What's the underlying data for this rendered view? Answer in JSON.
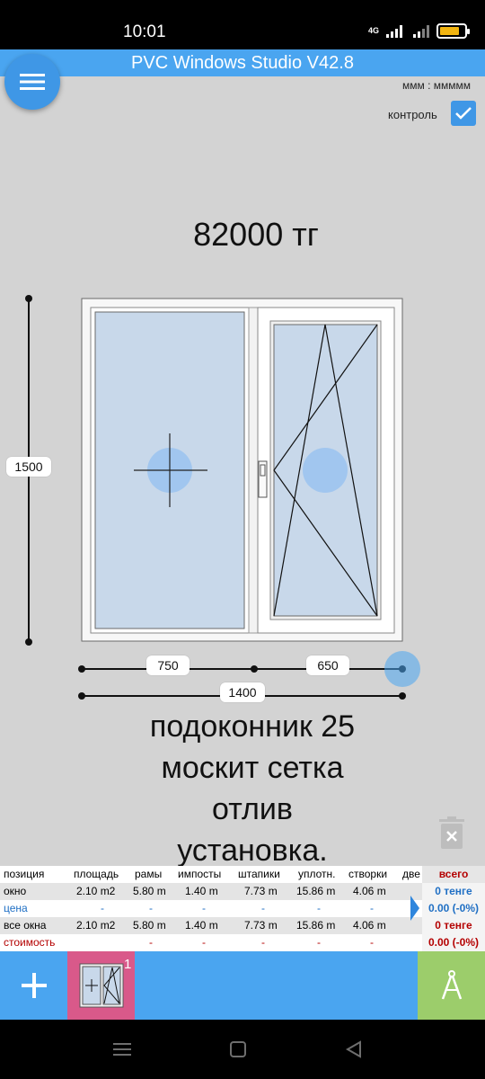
{
  "status": {
    "time": "10:01",
    "network": "4G",
    "battery_percent": 80
  },
  "app": {
    "title": "PVC Windows Studio V42.8",
    "units": "ммм : ммммм",
    "control_label": "контроль",
    "control_checked": true
  },
  "price": "82000 тг",
  "window": {
    "height": "1500",
    "sash_left_width": "750",
    "sash_right_width": "650",
    "total_width": "1400",
    "colors": {
      "glass": "#c8d8ea",
      "frame": "#f7f7f7",
      "handle_marker": "#9cc4ef"
    }
  },
  "notes": [
    "подоконник 25",
    "москит сетка",
    "отлив",
    "установка."
  ],
  "summary": {
    "headers": [
      "позиция",
      "площадь",
      "рамы",
      "импосты",
      "штапики",
      "уплотн.",
      "створки",
      "две",
      "всего"
    ],
    "rows": [
      {
        "label": "окно",
        "cells": [
          "2.10 m2",
          "5.80 m",
          "1.40 m",
          "7.73 m",
          "15.86 m",
          "4.06 m"
        ],
        "total": "0 тенге"
      },
      {
        "label": "цена",
        "cells": [
          "-",
          "-",
          "-",
          "-",
          "-",
          "-"
        ],
        "total": "0.00 (-0%)"
      },
      {
        "label": "все окна",
        "cells": [
          "2.10 m2",
          "5.80 m",
          "1.40 m",
          "7.73 m",
          "15.86 m",
          "4.06 m"
        ],
        "total": "0 тенге"
      },
      {
        "label": "стоимость",
        "cells": [
          "",
          "-",
          "-",
          "-",
          "-",
          "-"
        ],
        "total": "0.00 (-0%)"
      }
    ],
    "colors": {
      "blue": "#1f6fc4",
      "red": "#b40000"
    }
  },
  "toolbar": {
    "window_count": "1"
  },
  "icons": {
    "menu": "hamburger-icon",
    "check": "check-icon",
    "trash": "trash-icon",
    "add": "plus-icon",
    "compass": "compass-icon"
  }
}
